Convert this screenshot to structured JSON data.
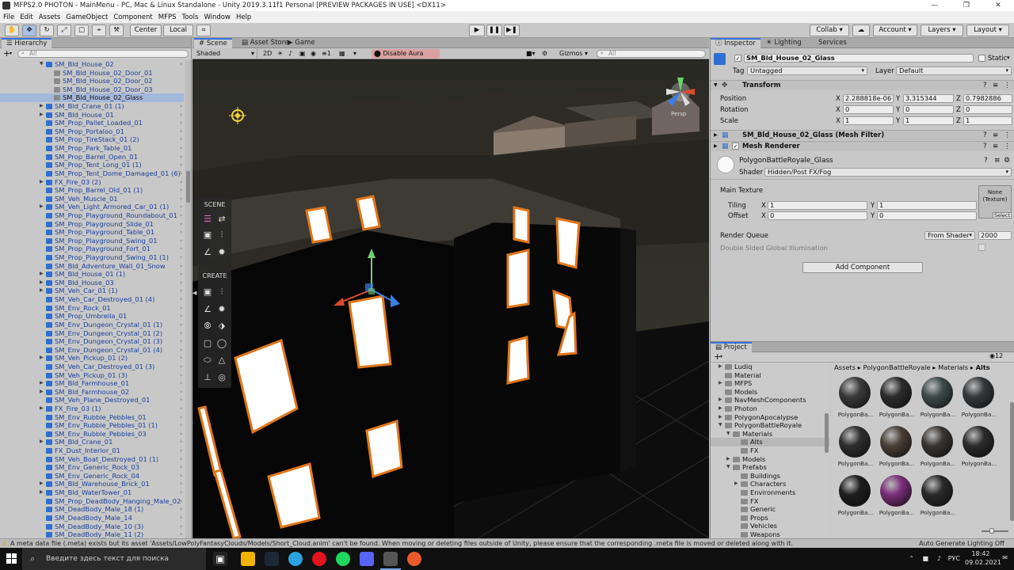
{
  "window": {
    "title": "MFPS2.0 PHOTON - MainMenu - PC, Mac & Linux Standalone - Unity 2019.3.11f1 Personal [PREVIEW PACKAGES IN USE] <DX11>"
  },
  "menu": [
    "File",
    "Edit",
    "Assets",
    "GameObject",
    "Component",
    "MFPS",
    "Tools",
    "Window",
    "Help"
  ],
  "toolbar": {
    "pivot_label": "Center",
    "space_label": "Local",
    "collab_label": "Collab",
    "account_label": "Account",
    "layers_label": "Layers",
    "layout_label": "Layout"
  },
  "hierarchy": {
    "tab": "Hierarchy",
    "add_label": "+",
    "search_placeholder": "All",
    "items": [
      {
        "label": "SM_Bld_House_02",
        "depth": 1,
        "expanded": true
      },
      {
        "label": "SM_Bld_House_02_Door_01",
        "depth": 2
      },
      {
        "label": "SM_Bld_House_02_Door_02",
        "depth": 2
      },
      {
        "label": "SM_Bld_House_02_Door_03",
        "depth": 2
      },
      {
        "label": "SM_Bld_House_02_Glass",
        "depth": 2,
        "selected": true
      },
      {
        "label": "SM_Bld_Crane_01 (1)",
        "depth": 1,
        "arrow": true
      },
      {
        "label": "SM_Bld_House_01",
        "depth": 1,
        "arrow": true
      },
      {
        "label": "SM_Prop_Pallet_Loaded_01",
        "depth": 1
      },
      {
        "label": "SM_Prop_Portaloo_01",
        "depth": 1
      },
      {
        "label": "SM_Prop_TireStack_01 (2)",
        "depth": 1
      },
      {
        "label": "SM_Prop_Park_Table_01",
        "depth": 1
      },
      {
        "label": "SM_Prop_Barrel_Open_01",
        "depth": 1
      },
      {
        "label": "SM_Prop_Tent_Long_01 (1)",
        "depth": 1
      },
      {
        "label": "SM_Prop_Tent_Dome_Damaged_01 (6)",
        "depth": 1
      },
      {
        "label": "FX_Fire_03 (2)",
        "depth": 1,
        "arrow": true
      },
      {
        "label": "SM_Prop_Barrel_Old_01 (1)",
        "depth": 1
      },
      {
        "label": "SM_Veh_Muscle_01",
        "depth": 1
      },
      {
        "label": "SM_Veh_Light_Armored_Car_01 (1)",
        "depth": 1,
        "arrow": true
      },
      {
        "label": "SM_Prop_Playground_Roundabout_01",
        "depth": 1
      },
      {
        "label": "SM_Prop_Playground_Slide_01",
        "depth": 1
      },
      {
        "label": "SM_Prop_Playground_Table_01",
        "depth": 1
      },
      {
        "label": "SM_Prop_Playground_Swing_01",
        "depth": 1
      },
      {
        "label": "SM_Prop_Playground_Fort_01",
        "depth": 1
      },
      {
        "label": "SM_Prop_Playground_Swing_01 (1)",
        "depth": 1
      },
      {
        "label": "SM_Bld_Adventure_Wall_01_Snow",
        "depth": 1
      },
      {
        "label": "SM_Bld_House_01 (1)",
        "depth": 1,
        "arrow": true
      },
      {
        "label": "SM_Bld_House_03",
        "depth": 1,
        "arrow": true
      },
      {
        "label": "SM_Veh_Car_01 (1)",
        "depth": 1,
        "arrow": true
      },
      {
        "label": "SM_Veh_Car_Destroyed_01 (4)",
        "depth": 1
      },
      {
        "label": "SM_Env_Rock_01",
        "depth": 1
      },
      {
        "label": "SM_Prop_Umbrella_01",
        "depth": 1
      },
      {
        "label": "SM_Env_Dungeon_Crystal_01 (1)",
        "depth": 1
      },
      {
        "label": "SM_Env_Dungeon_Crystal_01 (2)",
        "depth": 1
      },
      {
        "label": "SM_Env_Dungeon_Crystal_01 (3)",
        "depth": 1
      },
      {
        "label": "SM_Env_Dungeon_Crystal_01 (4)",
        "depth": 1
      },
      {
        "label": "SM_Veh_Pickup_01 (2)",
        "depth": 1,
        "arrow": true
      },
      {
        "label": "SM_Veh_Car_Destroyed_01 (3)",
        "depth": 1
      },
      {
        "label": "SM_Veh_Pickup_01 (3)",
        "depth": 1
      },
      {
        "label": "SM_Bld_Farmhouse_01",
        "depth": 1,
        "arrow": true
      },
      {
        "label": "SM_Bld_Farmhouse_02",
        "depth": 1,
        "arrow": true
      },
      {
        "label": "SM_Veh_Plane_Destroyed_01",
        "depth": 1
      },
      {
        "label": "FX_Fire_03 (1)",
        "depth": 1,
        "arrow": true
      },
      {
        "label": "SM_Env_Rubble_Pebbles_01",
        "depth": 1
      },
      {
        "label": "SM_Env_Rubble_Pebbles_01 (1)",
        "depth": 1
      },
      {
        "label": "SM_Env_Rubble_Pebbles_03",
        "depth": 1
      },
      {
        "label": "SM_Bld_Crane_01",
        "depth": 1,
        "arrow": true
      },
      {
        "label": "FX_Dust_Interior_01",
        "depth": 1
      },
      {
        "label": "SM_Veh_Boat_Destroyed_01 (1)",
        "depth": 1
      },
      {
        "label": "SM_Env_Generic_Rock_03",
        "depth": 1
      },
      {
        "label": "SM_Env_Generic_Rock_04",
        "depth": 1
      },
      {
        "label": "SM_Bld_Warehouse_Brick_01",
        "depth": 1,
        "arrow": true
      },
      {
        "label": "SM_Bld_WaterTower_01",
        "depth": 1,
        "arrow": true
      },
      {
        "label": "SM_Prop_DeadBody_Hanging_Male_02",
        "depth": 1
      },
      {
        "label": "SM_DeadBody_Male_18 (1)",
        "depth": 1
      },
      {
        "label": "SM_DeadBody_Male_14",
        "depth": 1
      },
      {
        "label": "SM_DeadBody_Male_10 (3)",
        "depth": 1
      },
      {
        "label": "SM_DeadBody_Male_11 (2)",
        "depth": 1
      }
    ]
  },
  "scene": {
    "tabs": [
      "Scene",
      "Asset Store",
      "Game"
    ],
    "draw_mode": "Shaded",
    "mode_2d": "2D",
    "layer_count": "1",
    "aura_button": "Disable Aura Preview",
    "gizmos_label": "Gizmos",
    "search_placeholder": "All",
    "overlay_scene_title": "SCENE",
    "overlay_create_title": "CREATE",
    "gizmo_label": "Persp"
  },
  "inspector": {
    "tabs": [
      "Inspector",
      "Lighting",
      "Services"
    ],
    "object_name": "SM_Bld_House_02_Glass",
    "static_label": "Static",
    "tag_label": "Tag",
    "tag_value": "Untagged",
    "layer_label": "Layer",
    "layer_value": "Default",
    "transform": {
      "title": "Transform",
      "position_label": "Position",
      "rotation_label": "Rotation",
      "scale_label": "Scale",
      "position": {
        "x": "2.288818e-06",
        "y": "3.315344",
        "z": "0.7982886"
      },
      "rotation": {
        "x": "0",
        "y": "0",
        "z": "0"
      },
      "scale": {
        "x": "1",
        "y": "1",
        "z": "1"
      }
    },
    "mesh_filter_title": "SM_Bld_House_02_Glass (Mesh Filter)",
    "mesh_renderer_title": "Mesh Renderer",
    "material": {
      "name": "PolygonBattleRoyale_Glass",
      "shader_label": "Shader",
      "shader_value": "Hidden/Post FX/Fog",
      "main_texture_label": "Main Texture",
      "texture_slot": "None\n(Texture)",
      "select_label": "Select",
      "tiling_label": "Tiling",
      "tiling": {
        "x": "1",
        "y": "1"
      },
      "offset_label": "Offset",
      "offset": {
        "x": "0",
        "y": "0"
      },
      "render_queue_label": "Render Queue",
      "render_queue_mode": "From Shader",
      "render_queue_value": "2000",
      "dsgi_label": "Double Sided Global Illumination"
    },
    "add_component_label": "Add Component"
  },
  "project": {
    "tab": "Project",
    "breadcrumb": [
      "Assets",
      "PolygonBattleRoyale",
      "Materials",
      "Alts"
    ],
    "item_count": "12",
    "tree": [
      {
        "label": "Ludiq",
        "depth": 0,
        "arrow": true
      },
      {
        "label": "Material",
        "depth": 0
      },
      {
        "label": "MFPS",
        "depth": 0,
        "arrow": true
      },
      {
        "label": "Models",
        "depth": 0
      },
      {
        "label": "NavMeshComponents",
        "depth": 0,
        "arrow": true
      },
      {
        "label": "Photon",
        "depth": 0,
        "arrow": true
      },
      {
        "label": "PolygonApocalypse",
        "depth": 0,
        "arrow": true
      },
      {
        "label": "PolygonBattleRoyale",
        "depth": 0,
        "expanded": true
      },
      {
        "label": "Materials",
        "depth": 1,
        "expanded": true
      },
      {
        "label": "Alts",
        "depth": 2,
        "selected": true
      },
      {
        "label": "FX",
        "depth": 2
      },
      {
        "label": "Models",
        "depth": 1,
        "arrow": true
      },
      {
        "label": "Prefabs",
        "depth": 1,
        "expanded": true
      },
      {
        "label": "Buildings",
        "depth": 2
      },
      {
        "label": "Characters",
        "depth": 2,
        "arrow": true
      },
      {
        "label": "Environments",
        "depth": 2
      },
      {
        "label": "FX",
        "depth": 2
      },
      {
        "label": "Generic",
        "depth": 2
      },
      {
        "label": "Props",
        "depth": 2
      },
      {
        "label": "Vehicles",
        "depth": 2
      },
      {
        "label": "Weapons",
        "depth": 2
      }
    ],
    "materials": [
      {
        "label": "PolygonBa...",
        "color": "#3a3a3a"
      },
      {
        "label": "PolygonBa...",
        "color": "#2c2c2c"
      },
      {
        "label": "PolygonBa...",
        "color": "#3e4b4b"
      },
      {
        "label": "PolygonBa...",
        "color": "#36393c"
      },
      {
        "label": "PolygonBa...",
        "color": "#2e2e2e"
      },
      {
        "label": "PolygonBa...",
        "color": "#4a3f36"
      },
      {
        "label": "PolygonBa...",
        "color": "#3b3531"
      },
      {
        "label": "PolygonBa...",
        "color": "#2b2b2b"
      },
      {
        "label": "PolygonBa...",
        "color": "#1e1e1e"
      },
      {
        "label": "PolygonBa...",
        "color": "#7a2e7a"
      },
      {
        "label": "PolygonBa...",
        "color": "#2a2a2a"
      }
    ]
  },
  "status": {
    "message": "A meta data file (.meta) exists but its asset 'Assets/LowPolyFantasyClouds/Models/Short_Cloud.anim' can't be found. When moving or deleting files outside of Unity, please ensure that the corresponding .meta file is moved or deleted along with it.",
    "right": "Auto Generate Lighting Off"
  },
  "taskbar": {
    "search_placeholder": "Введите здесь текст для поиска",
    "language": "РУС",
    "time": "18:42",
    "date": "09.02.2021"
  }
}
